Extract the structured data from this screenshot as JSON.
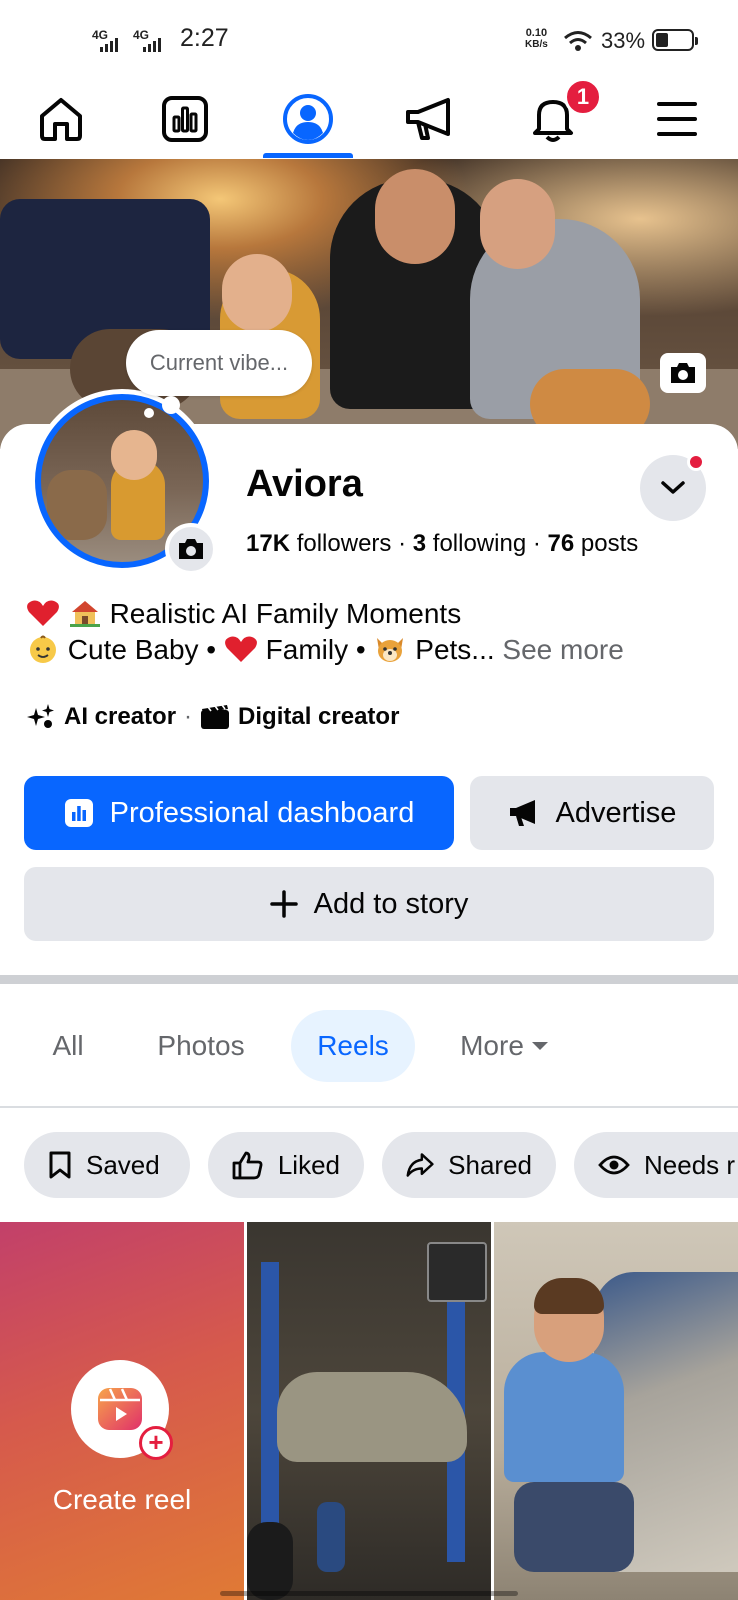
{
  "status_bar": {
    "signal1": "4G",
    "signal2": "4G",
    "time": "2:27",
    "net_speed": "0.10",
    "net_unit": "KB/s",
    "battery": "33%"
  },
  "nav": {
    "items": [
      "home-icon",
      "dashboard-icon",
      "profile-icon",
      "megaphone-icon",
      "bell-icon",
      "menu-icon"
    ],
    "notification_count": "1",
    "active": "profile",
    "accent": "#0866ff"
  },
  "cover": {
    "thought_bubble": "Current vibe..."
  },
  "profile": {
    "name": "Aviora",
    "followers_count": "17K",
    "followers_label": "followers",
    "following_count": "3",
    "following_label": "following",
    "posts_count": "76",
    "posts_label": "posts",
    "bio_line1": "Realistic AI Family Moments",
    "bio_line2_a": "Cute Baby •",
    "bio_line2_b": "Family •",
    "bio_line2_c": "Pets...",
    "see_more": "See more",
    "creator_1": "AI creator",
    "creator_sep": "·",
    "creator_2": "Digital creator"
  },
  "actions": {
    "professional_dashboard": "Professional dashboard",
    "advertise": "Advertise",
    "add_to_story": "Add to story"
  },
  "tabs": [
    "All",
    "Photos",
    "Reels",
    "More"
  ],
  "active_tab": "Reels",
  "chips": [
    "Saved",
    "Liked",
    "Shared",
    "Needs r"
  ],
  "reels": {
    "create_label": "Create reel"
  }
}
